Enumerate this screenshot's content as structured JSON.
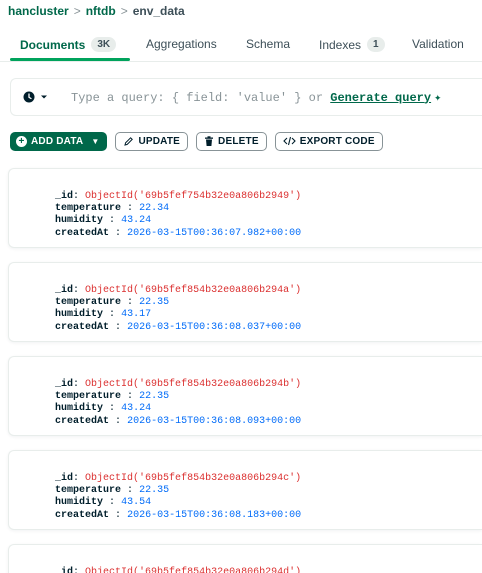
{
  "breadcrumb": {
    "cluster": "hancluster",
    "database": "nftdb",
    "collection": "env_data",
    "separator": ">"
  },
  "tabs": [
    {
      "label": "Documents",
      "badge": "3K",
      "active": true
    },
    {
      "label": "Aggregations",
      "badge": "",
      "active": false
    },
    {
      "label": "Schema",
      "badge": "",
      "active": false
    },
    {
      "label": "Indexes",
      "badge": "1",
      "active": false
    },
    {
      "label": "Validation",
      "badge": "",
      "active": false
    }
  ],
  "query": {
    "options_icon": "clock-icon",
    "placeholder_prefix": "Type a query: { field: 'value' } or ",
    "generate_link": "Generate query",
    "sparkle_icon": "sparkle-icon"
  },
  "toolbar": {
    "add_data": "ADD DATA",
    "update": "UPDATE",
    "delete": "DELETE",
    "export_code": "EXPORT CODE"
  },
  "fields": {
    "id": "_id",
    "temperature": "temperature",
    "humidity": "humidity",
    "createdAt": "createdAt",
    "colon": ":"
  },
  "documents": [
    {
      "_id": "ObjectId('69b5fef754b32e0a806b2949')",
      "temperature": "22.34",
      "humidity": "43.24",
      "createdAt": "2026-03-15T00:36:07.982+00:00"
    },
    {
      "_id": "ObjectId('69b5fef854b32e0a806b294a')",
      "temperature": "22.35",
      "humidity": "43.17",
      "createdAt": "2026-03-15T00:36:08.037+00:00"
    },
    {
      "_id": "ObjectId('69b5fef854b32e0a806b294b')",
      "temperature": "22.35",
      "humidity": "43.24",
      "createdAt": "2026-03-15T00:36:08.093+00:00"
    },
    {
      "_id": "ObjectId('69b5fef854b32e0a806b294c')",
      "temperature": "22.35",
      "humidity": "43.54",
      "createdAt": "2026-03-15T00:36:08.183+00:00"
    },
    {
      "_id": "ObjectId('69b5fef854b32e0a806b294d')"
    }
  ],
  "colors": {
    "brand_green": "#00684a",
    "tab_underline": "#00a35c",
    "objectid_red": "#db3030",
    "value_blue": "#016bf8"
  }
}
